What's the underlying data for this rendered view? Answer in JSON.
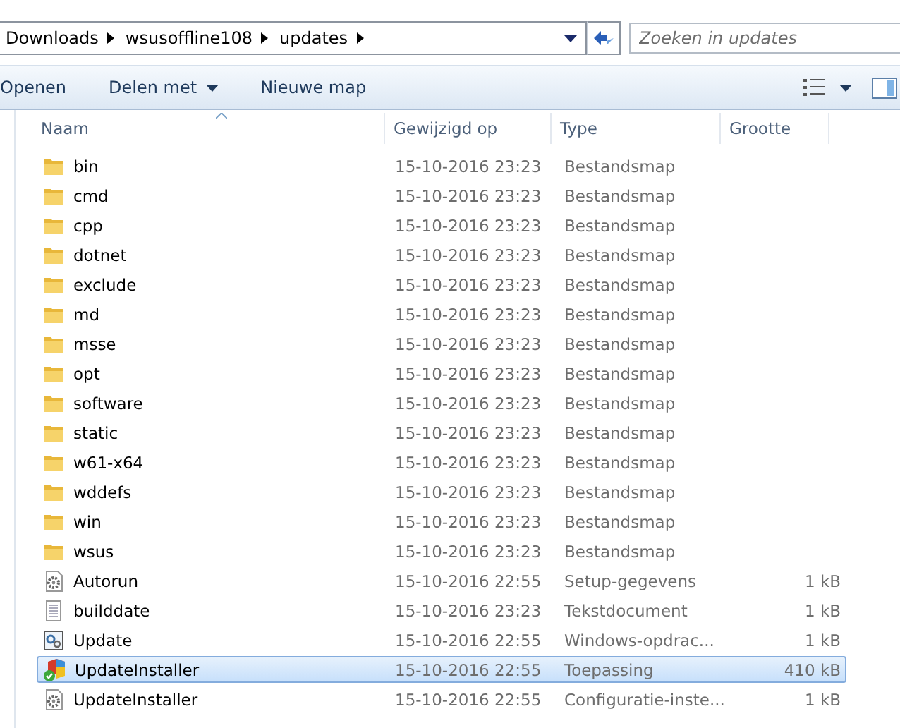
{
  "address": {
    "crumbs": [
      "Downloads",
      "wsusoffline108",
      "updates"
    ]
  },
  "search": {
    "placeholder": "Zoeken in updates"
  },
  "toolbar": {
    "buttons": [
      {
        "label": "Openen",
        "menu": false
      },
      {
        "label": "Delen met",
        "menu": true
      },
      {
        "label": "Nieuwe map",
        "menu": false
      }
    ]
  },
  "table": {
    "columns": [
      "Naam",
      "Gewijzigd op",
      "Type",
      "Grootte"
    ],
    "rows": [
      {
        "kind": "folder",
        "name": "bin",
        "modified": "15-10-2016 23:23",
        "type": "Bestandsmap",
        "selected": false
      },
      {
        "kind": "folder",
        "name": "cmd",
        "modified": "15-10-2016 23:23",
        "type": "Bestandsmap",
        "selected": false
      },
      {
        "kind": "folder",
        "name": "cpp",
        "modified": "15-10-2016 23:23",
        "type": "Bestandsmap",
        "selected": false
      },
      {
        "kind": "folder",
        "name": "dotnet",
        "modified": "15-10-2016 23:23",
        "type": "Bestandsmap",
        "selected": false
      },
      {
        "kind": "folder",
        "name": "exclude",
        "modified": "15-10-2016 23:23",
        "type": "Bestandsmap",
        "selected": false
      },
      {
        "kind": "folder",
        "name": "md",
        "modified": "15-10-2016 23:23",
        "type": "Bestandsmap",
        "selected": false
      },
      {
        "kind": "folder",
        "name": "msse",
        "modified": "15-10-2016 23:23",
        "type": "Bestandsmap",
        "selected": false
      },
      {
        "kind": "folder",
        "name": "opt",
        "modified": "15-10-2016 23:23",
        "type": "Bestandsmap",
        "selected": false
      },
      {
        "kind": "folder",
        "name": "software",
        "modified": "15-10-2016 23:23",
        "type": "Bestandsmap",
        "selected": false
      },
      {
        "kind": "folder",
        "name": "static",
        "modified": "15-10-2016 23:23",
        "type": "Bestandsmap",
        "selected": false
      },
      {
        "kind": "folder",
        "name": "w61-x64",
        "modified": "15-10-2016 23:23",
        "type": "Bestandsmap",
        "selected": false
      },
      {
        "kind": "folder",
        "name": "wddefs",
        "modified": "15-10-2016 23:23",
        "type": "Bestandsmap",
        "selected": false
      },
      {
        "kind": "folder",
        "name": "win",
        "modified": "15-10-2016 23:23",
        "type": "Bestandsmap",
        "selected": false
      },
      {
        "kind": "folder",
        "name": "wsus",
        "modified": "15-10-2016 23:23",
        "type": "Bestandsmap",
        "selected": false
      },
      {
        "kind": "settings",
        "name": "Autorun",
        "modified": "15-10-2016 22:55",
        "type": "Setup-gegevens",
        "size": "1 kB",
        "selected": false
      },
      {
        "kind": "text",
        "name": "builddate",
        "modified": "15-10-2016 23:23",
        "type": "Tekstdocument",
        "size": "1 kB",
        "selected": false
      },
      {
        "kind": "script",
        "name": "Update",
        "modified": "15-10-2016 22:55",
        "type": "Windows-opdrac...",
        "size": "1 kB",
        "selected": false
      },
      {
        "kind": "app",
        "name": "UpdateInstaller",
        "modified": "15-10-2016 22:55",
        "type": "Toepassing",
        "size": "410 kB",
        "selected": true
      },
      {
        "kind": "settings",
        "name": "UpdateInstaller",
        "modified": "15-10-2016 22:55",
        "type": "Configuratie-inste...",
        "size": "1 kB",
        "selected": false
      }
    ]
  }
}
